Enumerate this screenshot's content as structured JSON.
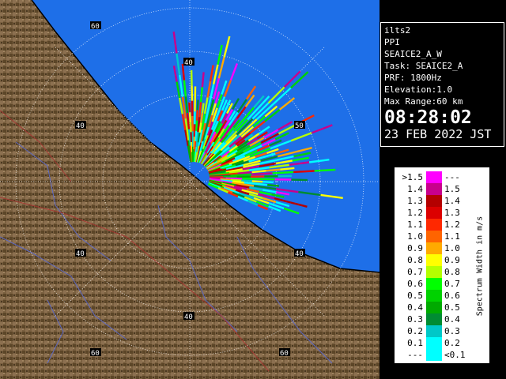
{
  "info": {
    "station": "ilts2",
    "product": "PPI",
    "scan": "SEAICE2_A_W",
    "task": "Task: SEAICE2_A",
    "prf": "PRF: 1800Hz",
    "elevation": "Elevation:1.0",
    "max_range": "Max Range:60 km",
    "time": "08:28:02",
    "date": "23 FEB 2022 JST"
  },
  "legend": {
    "unit": "Spectrum Width in m/s",
    "rows": [
      {
        "left": ">1.5",
        "right": "---",
        "color": "#ff00ff"
      },
      {
        "left": "1.4",
        "right": "1.5",
        "color": "#c8008c"
      },
      {
        "left": "1.3",
        "right": "1.4",
        "color": "#b40000"
      },
      {
        "left": "1.2",
        "right": "1.3",
        "color": "#dc0000"
      },
      {
        "left": "1.1",
        "right": "1.2",
        "color": "#ff2800"
      },
      {
        "left": "1.0",
        "right": "1.1",
        "color": "#ff6400"
      },
      {
        "left": "0.9",
        "right": "1.0",
        "color": "#ffaa00"
      },
      {
        "left": "0.8",
        "right": "0.9",
        "color": "#ffff00"
      },
      {
        "left": "0.7",
        "right": "0.8",
        "color": "#b4ff00"
      },
      {
        "left": "0.6",
        "right": "0.7",
        "color": "#00ff00"
      },
      {
        "left": "0.5",
        "right": "0.6",
        "color": "#00d200"
      },
      {
        "left": "0.4",
        "right": "0.5",
        "color": "#00aa00"
      },
      {
        "left": "0.3",
        "right": "0.4",
        "color": "#008c32"
      },
      {
        "left": "0.2",
        "right": "0.3",
        "color": "#00c8c8"
      },
      {
        "left": "0.1",
        "right": "0.2",
        "color": "#00ffff"
      },
      {
        "left": "---",
        "right": "<0.1",
        "color": "#00ffff"
      }
    ]
  },
  "radar": {
    "ring_labels": [
      "40",
      "60",
      "50"
    ],
    "land_color": "#7a6040",
    "sea_color": "#1e6fe8"
  }
}
